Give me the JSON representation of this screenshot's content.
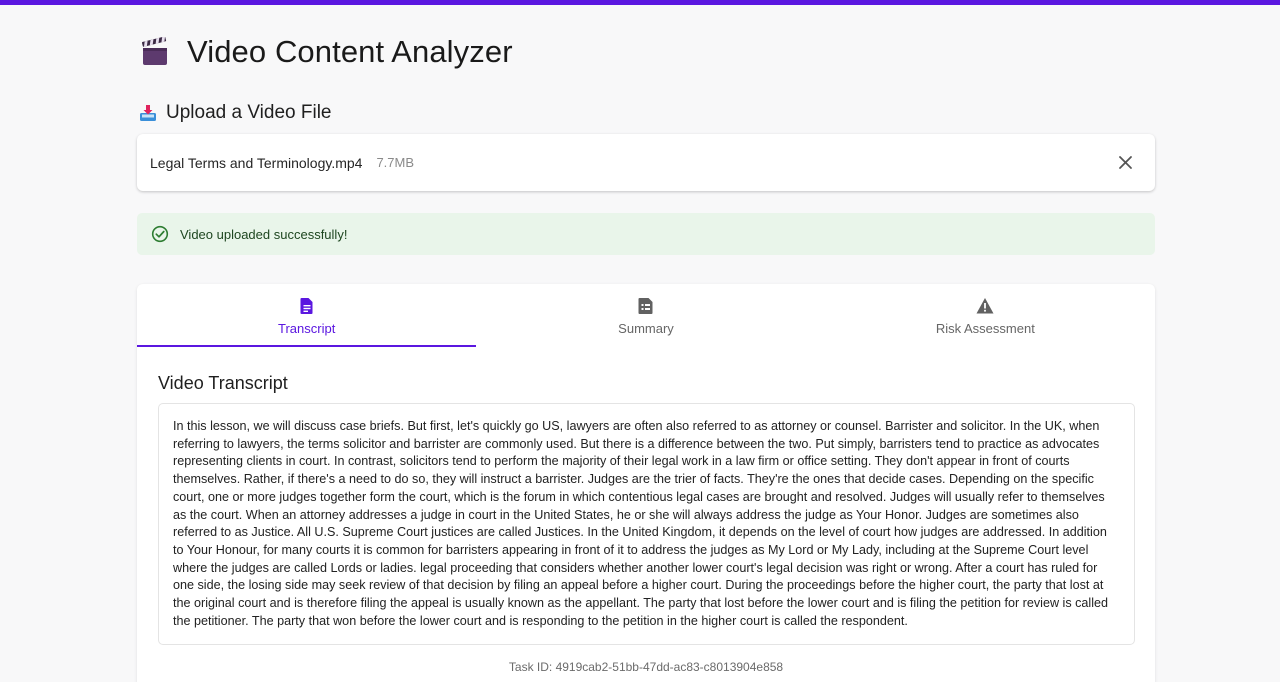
{
  "app": {
    "title": "Video Content Analyzer",
    "title_icon": "clapperboard-icon",
    "accent_color": "#5b17e0"
  },
  "upload": {
    "heading": "Upload a Video File",
    "heading_icon": "inbox-tray-icon",
    "file": {
      "name": "Legal Terms and Terminology.mp4",
      "size": "7.7MB"
    },
    "remove_icon": "close-icon"
  },
  "alert": {
    "message": "Video uploaded successfully!",
    "icon": "check-circle-icon",
    "background": "#e9f5ea"
  },
  "tabs": [
    {
      "label": "Transcript",
      "icon": "document-icon",
      "active": true
    },
    {
      "label": "Summary",
      "icon": "summary-document-icon",
      "active": false
    },
    {
      "label": "Risk Assessment",
      "icon": "warning-icon",
      "active": false
    }
  ],
  "transcript": {
    "heading": "Video Transcript",
    "text": "In this lesson, we will discuss case briefs. But first, let's quickly go US, lawyers are often also referred to as attorney or counsel. Barrister and solicitor. In the UK, when referring to lawyers, the terms solicitor and barrister are commonly used. But there is a difference between the two. Put simply, barristers tend to practice as advocates representing clients in court. In contrast, solicitors tend to perform the majority of their legal work in a law firm or office setting. They don't appear in front of courts themselves. Rather, if there's a need to do so, they will instruct a barrister. Judges are the trier of facts. They're the ones that decide cases. Depending on the specific court, one or more judges together form the court, which is the forum in which contentious legal cases are brought and resolved. Judges will usually refer to themselves as the court. When an attorney addresses a judge in court in the United States, he or she will always address the judge as Your Honor. Judges are sometimes also referred to as Justice. All U.S. Supreme Court justices are called Justices. In the United Kingdom, it depends on the level of court how judges are addressed. In addition to Your Honour, for many courts it is common for barristers appearing in front of it to address the judges as My Lord or My Lady, including at the Supreme Court level where the judges are called Lords or ladies. legal proceeding that considers whether another lower court's legal decision was right or wrong. After a court has ruled for one side, the losing side may seek review of that decision by filing an appeal before a higher court. During the proceedings before the higher court, the party that lost at the original court and is therefore filing the appeal is usually known as the appellant. The party that lost before the lower court and is filing the petition for review is called the petitioner. The party that won before the lower court and is responding to the petition in the higher court is called the respondent."
  },
  "footer": {
    "task_id": "Task ID: 4919cab2-51bb-47dd-ac83-c8013904e858"
  }
}
